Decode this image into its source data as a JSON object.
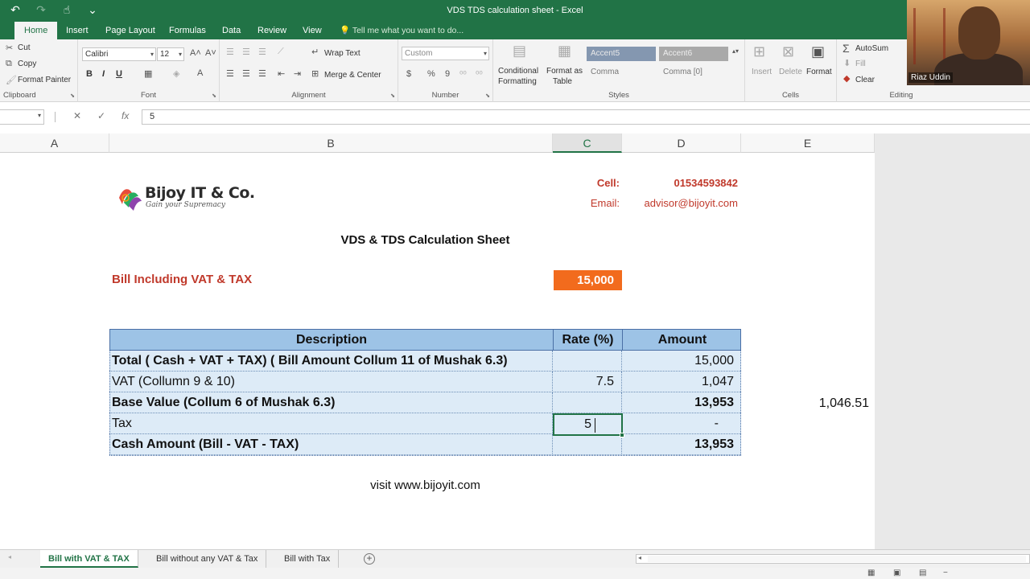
{
  "window": {
    "title": "VDS TDS calculation sheet - Excel"
  },
  "qat": {
    "undo": "↶",
    "redo": "↷",
    "touch": "☝",
    "customize": "⌄"
  },
  "tabs": [
    "Home",
    "Insert",
    "Page Layout",
    "Formulas",
    "Data",
    "Review",
    "View"
  ],
  "tell_me": "Tell me what you want to do...",
  "ribbon": {
    "clipboard": {
      "cut": "Cut",
      "copy": "Copy",
      "format_painter": "Format Painter",
      "label": "Clipboard"
    },
    "font": {
      "name": "Calibri",
      "size": "12",
      "bold": "B",
      "italic": "I",
      "underline": "U",
      "label": "Font"
    },
    "alignment": {
      "wrap_text": "Wrap Text",
      "merge_center": "Merge & Center",
      "label": "Alignment"
    },
    "number": {
      "format": "Custom",
      "currency": "$",
      "percent": "%",
      "comma": "9",
      "label": "Number"
    },
    "styles": {
      "conditional_formatting_1": "Conditional",
      "conditional_formatting_2": "Formatting",
      "format_as_table_1": "Format as",
      "format_as_table_2": "Table",
      "accent5": "Accent5",
      "accent6": "Accent6",
      "comma": "Comma",
      "comma0": "Comma [0]",
      "label": "Styles"
    },
    "cells": {
      "insert": "Insert",
      "delete": "Delete",
      "format": "Format",
      "label": "Cells"
    },
    "editing": {
      "autosum": "AutoSum",
      "fill": "Fill",
      "clear": "Clear",
      "label": "Editing"
    }
  },
  "webcam": {
    "name": "Riaz Uddin"
  },
  "formula_bar": {
    "name_box": "",
    "value": "5"
  },
  "columns": [
    "A",
    "B",
    "C",
    "D",
    "E"
  ],
  "logo": {
    "name": "Bijoy IT & Co.",
    "tagline": "Gain your Supremacy"
  },
  "contact": {
    "cell_label": "Cell:",
    "cell_value": "01534593842",
    "email_label": "Email:",
    "email_value": "advisor@bijoyit.com"
  },
  "sheet_title": "VDS & TDS Calculation Sheet",
  "bill": {
    "label": "Bill Including VAT & TAX",
    "value": "15,000"
  },
  "table": {
    "headers": {
      "description": "Description",
      "rate": "Rate (%)",
      "amount": "Amount"
    },
    "rows": [
      {
        "description": "Total ( Cash + VAT + TAX) ( Bill Amount Collum 11 of Mushak 6.3)",
        "rate": "",
        "amount": "15,000"
      },
      {
        "description": "VAT (Collumn 9 & 10)",
        "rate": "7.5",
        "amount": "1,047"
      },
      {
        "description": "Base Value (Collum 6 of Mushak 6.3)",
        "rate": "",
        "amount": "13,953"
      },
      {
        "description": "Tax",
        "rate": "5",
        "amount": "-"
      },
      {
        "description": "Cash Amount (Bill - VAT - TAX)",
        "rate": "",
        "amount": "13,953"
      }
    ]
  },
  "side_value": "1,046.51",
  "footer_text": "visit www.bijoyit.com",
  "sheet_tabs": [
    "Bill with VAT & TAX",
    "Bill without any VAT & Tax",
    "Bill with Tax"
  ],
  "colors": {
    "excel_green": "#217346",
    "accent_red": "#c0392b",
    "bill_orange": "#f26b1d",
    "table_header": "#9dc3e6",
    "table_body": "#ddebf7"
  }
}
